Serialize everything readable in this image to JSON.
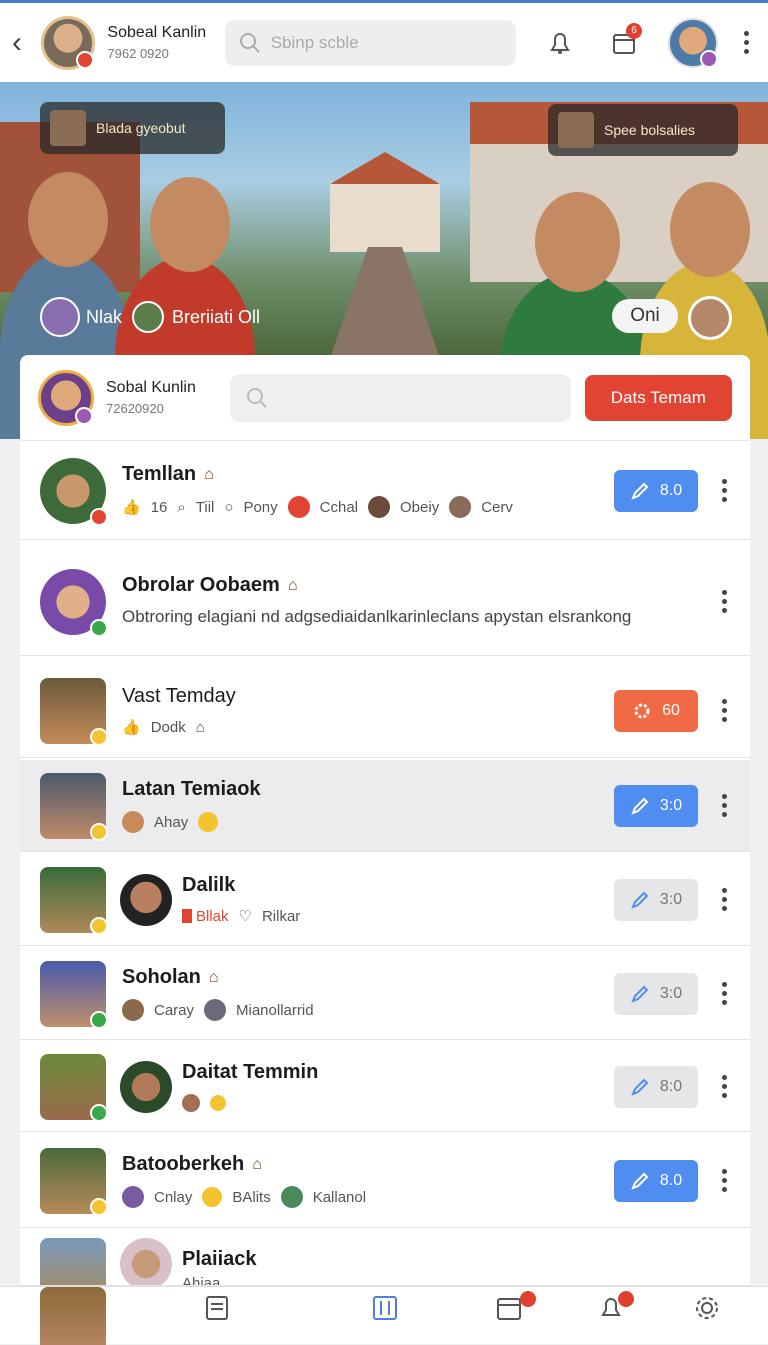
{
  "topbar": {
    "name": "Sobeal Kanlin",
    "id": "7962 0920",
    "search_placeholder": "Sbinp scble",
    "notification_count": "6"
  },
  "hero": {
    "card_left": "Blada gyeobut",
    "card_right": "Spee bolsalies",
    "chip_a": "Nlak",
    "chip_b": "Breriiati Oll",
    "toggle": "Oni"
  },
  "panel": {
    "user_name": "Sobal Kunlin",
    "user_id": "72620920",
    "cta": "Dats Temam"
  },
  "rows": [
    {
      "title": "Temllan",
      "meta": [
        "16",
        "Tiil",
        "Pony",
        "Cchal",
        "Obeiy",
        "Cerv"
      ],
      "btn": "8.0"
    },
    {
      "title": "Obrolar Oobaem",
      "desc": "Obtroring elagiani nd adgsediaidanlkarinleclans apystan elsrankong"
    },
    {
      "title": "Vast Temday",
      "meta": [
        "Dodk"
      ],
      "btn": "60"
    },
    {
      "title": "Latan Temiaok",
      "meta": [
        "Ahay"
      ],
      "btn": "3:0"
    },
    {
      "title": "Dalilk",
      "meta": [
        "Bllak",
        "Rilkar"
      ],
      "btn": "3:0"
    },
    {
      "title": "Soholan",
      "meta": [
        "Caray",
        "Mianollarrid"
      ],
      "btn": "3:0"
    },
    {
      "title": "Daitat Temmin",
      "meta": [],
      "btn": "8:0"
    },
    {
      "title": "Batooberkeh",
      "meta": [
        "Cnlay",
        "BAlits",
        "Kallanol"
      ],
      "btn": "8.0"
    },
    {
      "title": "Plaiiack",
      "meta": [
        "Ahiaa"
      ]
    }
  ],
  "icons": [
    "back-icon",
    "search-icon",
    "bell-icon",
    "calendar-icon",
    "more-icon",
    "edit-icon",
    "gear-icon",
    "thumb-icon",
    "home-icon"
  ],
  "colors": {
    "accent_blue": "#4f8ef0",
    "cta_red": "#e14433",
    "orange": "#f06a45"
  }
}
